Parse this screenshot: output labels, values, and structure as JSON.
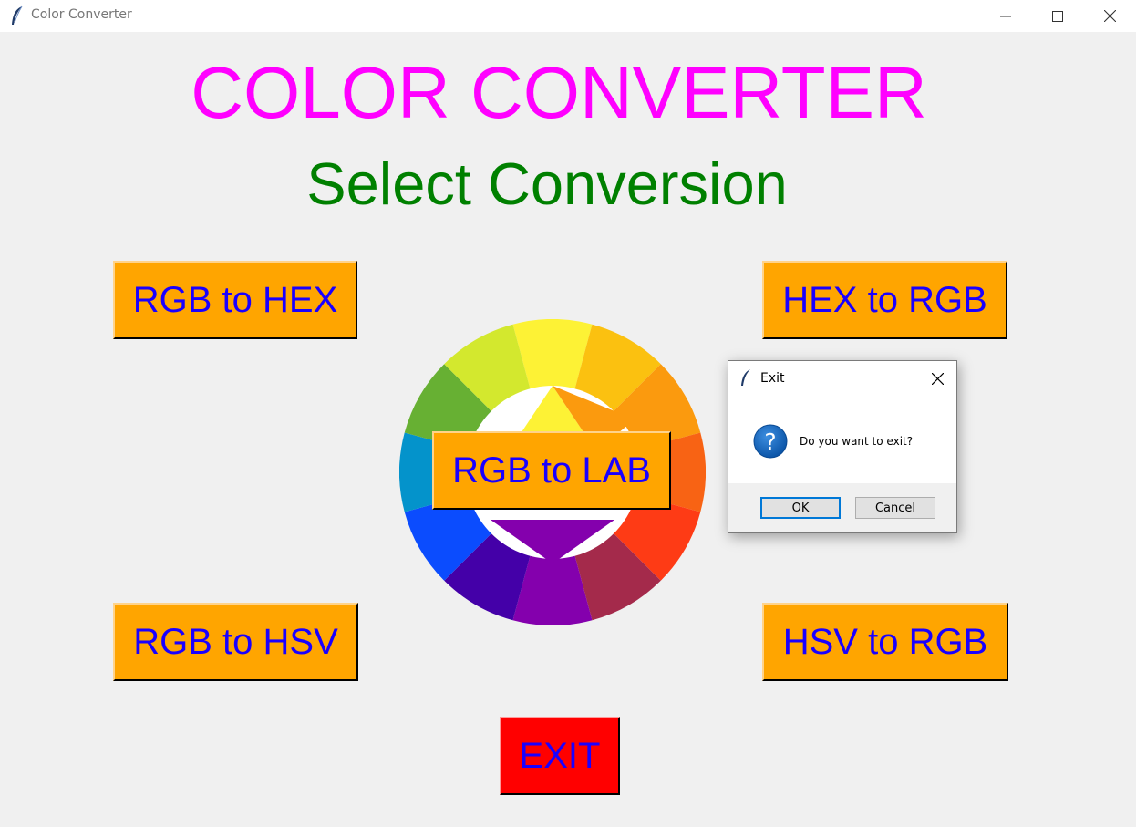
{
  "window": {
    "title": "Color Converter",
    "icon": "feather-icon",
    "controls": [
      "minimize-icon",
      "maximize-icon",
      "close-icon"
    ]
  },
  "main": {
    "title": "COLOR CONVERTER",
    "title_color": "#ff00ff",
    "subtitle": "Select Conversion",
    "subtitle_color": "#008000"
  },
  "buttons": {
    "rgb_to_hex": "RGB to HEX",
    "hex_to_rgb": "HEX to RGB",
    "rgb_to_lab": "RGB to LAB",
    "rgb_to_hsv": "RGB to HSV",
    "hsv_to_rgb": "HSV to RGB",
    "exit": "EXIT",
    "bg_color": "#ffa500",
    "exit_bg_color": "#ff0000",
    "text_color": "#1a00ff"
  },
  "color_wheel": {
    "segments": [
      "#fdf235",
      "#fbc110",
      "#fb9a0e",
      "#f86314",
      "#fe3b15",
      "#a42a4b",
      "#8400ad",
      "#4400a8",
      "#0b4cfe",
      "#0493cb",
      "#67b033",
      "#d3e82e"
    ],
    "inner_triangle_colors": [
      "#fdf235",
      "#fb9a0e",
      "#8400ad"
    ]
  },
  "dialog": {
    "title": "Exit",
    "icon": "feather-icon",
    "message_icon": "question-icon",
    "message": "Do you want to exit?",
    "ok_label": "OK",
    "cancel_label": "Cancel"
  }
}
